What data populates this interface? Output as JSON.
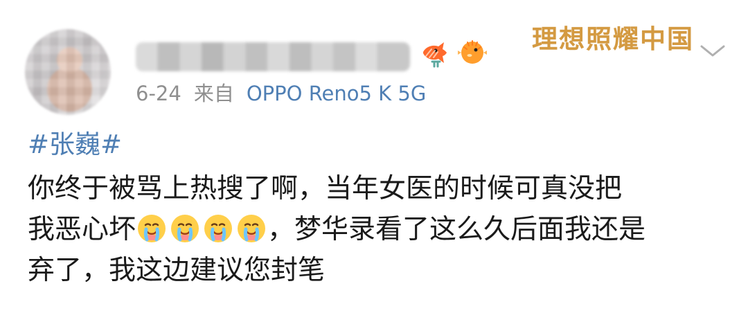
{
  "header": {
    "watermark": "理想照耀中国"
  },
  "meta": {
    "date": "6-24",
    "from": "来自",
    "device": "OPPO Reno5 K 5G"
  },
  "post": {
    "hashtag": "#张巍#",
    "line1": "你终于被骂上热搜了啊，当年女医的时候可真没把",
    "line2_prefix": "我恶心坏",
    "line2_suffix": "，梦华录看了这么久后面我还是",
    "line3": "弃了，我这边建议您封笔"
  },
  "icons": {
    "badges": [
      "fish-icon",
      "puffer-icon"
    ],
    "emoji_repeat": [
      "crying-emoji",
      "crying-emoji",
      "crying-emoji",
      "crying-emoji"
    ],
    "chevron": "chevron-down-icon"
  },
  "colors": {
    "link": "#4f7fb4",
    "muted": "#8f8f8f",
    "watermark": "#d49a41",
    "text": "#1a1a1a"
  }
}
